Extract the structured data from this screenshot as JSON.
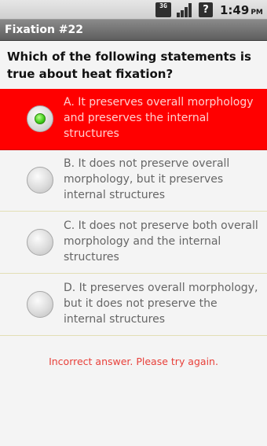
{
  "status_bar": {
    "network_label": "3G",
    "battery_label": "?",
    "time": "1:49",
    "ampm": "PM"
  },
  "title_bar": {
    "title": "Fixation #22"
  },
  "question": "Which of the following statements is true about heat fixation?",
  "options": [
    {
      "label": "A. It preserves overall morphology and preserves the internal structures",
      "selected": true
    },
    {
      "label": "B. It does not preserve overall morphology, but it preserves internal structures",
      "selected": false
    },
    {
      "label": "C. It does not preserve both overall morphology and the internal structures",
      "selected": false
    },
    {
      "label": "D. It preserves overall morphology, but it does not preserve the internal structures",
      "selected": false
    }
  ],
  "feedback": "Incorrect answer. Please try again.",
  "colors": {
    "selected_background": "#ff0000",
    "feedback_text": "#e8403a",
    "radio_checked": "#3fcc1a"
  }
}
